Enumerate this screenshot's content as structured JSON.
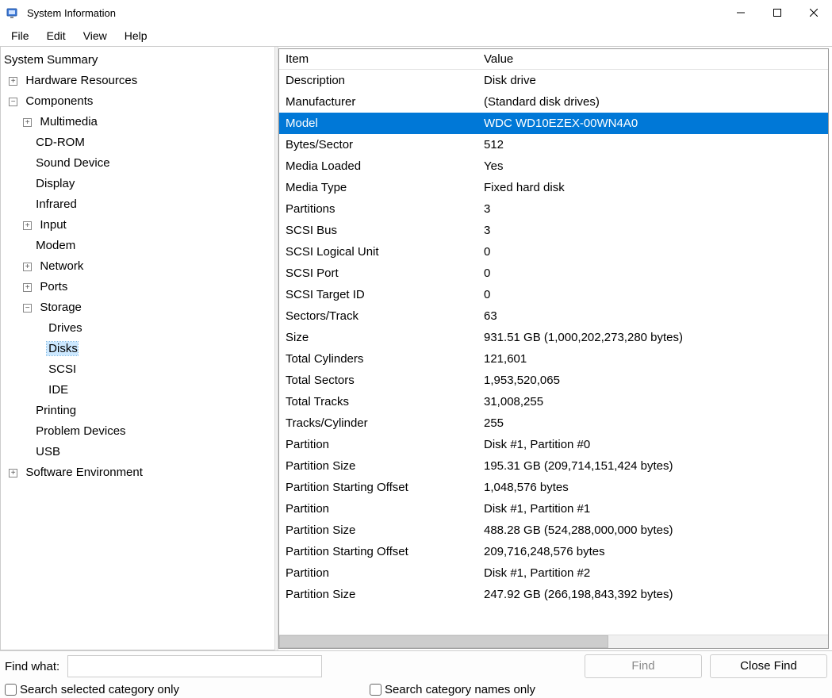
{
  "window": {
    "title": "System Information"
  },
  "menu": {
    "file": "File",
    "edit": "Edit",
    "view": "View",
    "help": "Help"
  },
  "tree": {
    "root": "System Summary",
    "hardware": "Hardware Resources",
    "components": "Components",
    "multimedia": "Multimedia",
    "cdrom": "CD-ROM",
    "sound": "Sound Device",
    "display": "Display",
    "infrared": "Infrared",
    "input": "Input",
    "modem": "Modem",
    "network": "Network",
    "ports": "Ports",
    "storage": "Storage",
    "drives": "Drives",
    "disks": "Disks",
    "scsi": "SCSI",
    "ide": "IDE",
    "printing": "Printing",
    "problem": "Problem Devices",
    "usb": "USB",
    "software": "Software Environment"
  },
  "columns": {
    "item": "Item",
    "value": "Value"
  },
  "rows": [
    {
      "item": "Description",
      "value": "Disk drive",
      "selected": false
    },
    {
      "item": "Manufacturer",
      "value": "(Standard disk drives)",
      "selected": false
    },
    {
      "item": "Model",
      "value": "WDC WD10EZEX-00WN4A0",
      "selected": true
    },
    {
      "item": "Bytes/Sector",
      "value": "512",
      "selected": false
    },
    {
      "item": "Media Loaded",
      "value": "Yes",
      "selected": false
    },
    {
      "item": "Media Type",
      "value": "Fixed hard disk",
      "selected": false
    },
    {
      "item": "Partitions",
      "value": "3",
      "selected": false
    },
    {
      "item": "SCSI Bus",
      "value": "3",
      "selected": false
    },
    {
      "item": "SCSI Logical Unit",
      "value": "0",
      "selected": false
    },
    {
      "item": "SCSI Port",
      "value": "0",
      "selected": false
    },
    {
      "item": "SCSI Target ID",
      "value": "0",
      "selected": false
    },
    {
      "item": "Sectors/Track",
      "value": "63",
      "selected": false
    },
    {
      "item": "Size",
      "value": "931.51 GB (1,000,202,273,280 bytes)",
      "selected": false
    },
    {
      "item": "Total Cylinders",
      "value": "121,601",
      "selected": false
    },
    {
      "item": "Total Sectors",
      "value": "1,953,520,065",
      "selected": false
    },
    {
      "item": "Total Tracks",
      "value": "31,008,255",
      "selected": false
    },
    {
      "item": "Tracks/Cylinder",
      "value": "255",
      "selected": false
    },
    {
      "item": "Partition",
      "value": "Disk #1, Partition #0",
      "selected": false
    },
    {
      "item": "Partition Size",
      "value": "195.31 GB (209,714,151,424 bytes)",
      "selected": false
    },
    {
      "item": "Partition Starting Offset",
      "value": "1,048,576 bytes",
      "selected": false
    },
    {
      "item": "Partition",
      "value": "Disk #1, Partition #1",
      "selected": false
    },
    {
      "item": "Partition Size",
      "value": "488.28 GB (524,288,000,000 bytes)",
      "selected": false
    },
    {
      "item": "Partition Starting Offset",
      "value": "209,716,248,576 bytes",
      "selected": false
    },
    {
      "item": "Partition",
      "value": "Disk #1, Partition #2",
      "selected": false
    },
    {
      "item": "Partition Size",
      "value": "247.92 GB (266,198,843,392 bytes)",
      "selected": false
    }
  ],
  "find": {
    "label": "Find what:",
    "value": "",
    "find_btn": "Find",
    "close_btn": "Close Find",
    "chk_selected": "Search selected category only",
    "chk_names": "Search category names only"
  },
  "expander": {
    "plus": "+",
    "minus": "−"
  }
}
